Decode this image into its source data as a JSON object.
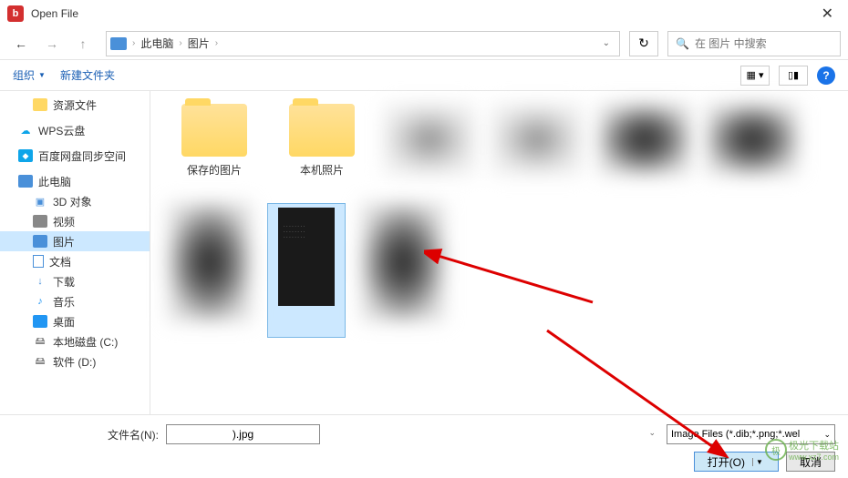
{
  "title": "Open File",
  "path": {
    "segments": [
      "此电脑",
      "图片"
    ]
  },
  "search": {
    "placeholder": "在 图片 中搜索"
  },
  "toolbar": {
    "organize": "组织",
    "newfolder": "新建文件夹"
  },
  "sidebar": {
    "items": [
      {
        "label": "资源文件"
      },
      {
        "label": "WPS云盘"
      },
      {
        "label": "百度网盘同步空间"
      },
      {
        "label": "此电脑"
      },
      {
        "label": "3D 对象"
      },
      {
        "label": "视频"
      },
      {
        "label": "图片"
      },
      {
        "label": "文档"
      },
      {
        "label": "下载"
      },
      {
        "label": "音乐"
      },
      {
        "label": "桌面"
      },
      {
        "label": "本地磁盘 (C:)"
      },
      {
        "label": "软件 (D:)"
      }
    ]
  },
  "files": {
    "folder1": "保存的图片",
    "folder2": "本机照片"
  },
  "bottom": {
    "fname_label": "文件名(N):",
    "fname_value": ").jpg",
    "filter": "Image Files (*.dib;*.png;*.wel",
    "open": "打开(O)",
    "cancel": "取消"
  },
  "watermark": {
    "site": "极光下载站",
    "url": "www.xz7.com"
  }
}
